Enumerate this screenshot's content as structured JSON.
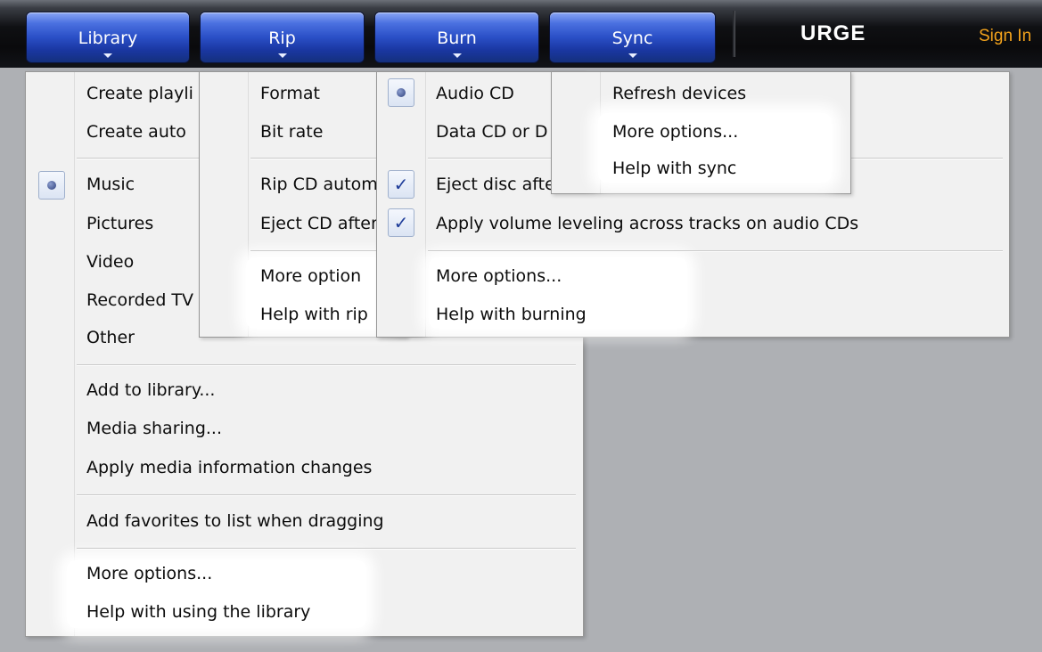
{
  "toolbar": {
    "tabs": [
      "Library",
      "Rip",
      "Burn",
      "Sync"
    ],
    "brand": "URGE",
    "sign_in": "Sign In"
  },
  "library_menu": {
    "items": [
      "Create playli",
      "Create auto",
      "Music",
      "Pictures",
      "Video",
      "Recorded TV",
      "Other",
      "Add to library...",
      "Media sharing...",
      "Apply media information changes",
      "Add favorites to list when dragging",
      "More options...",
      "Help with using the library"
    ],
    "selected": "Music"
  },
  "rip_menu": {
    "items": [
      "Format",
      "Bit rate",
      "Rip CD autom",
      "Eject CD after",
      "More option",
      "Help with rip"
    ]
  },
  "burn_menu": {
    "items": [
      "Audio CD",
      "Data CD or D",
      "Eject disc after",
      "Apply volume leveling across tracks on audio CDs",
      "More options...",
      "Help with burning"
    ],
    "selected": "Audio CD",
    "checked": [
      "Eject disc after",
      "Apply volume leveling across tracks on audio CDs"
    ]
  },
  "sync_menu": {
    "items": [
      "Refresh devices",
      "More options...",
      "Help with sync"
    ]
  },
  "icons": {
    "check": "✓"
  },
  "colors": {
    "tab_blue": "#2a4fc6",
    "sign_in": "#f2a21c",
    "background": "#aeb0b4"
  }
}
